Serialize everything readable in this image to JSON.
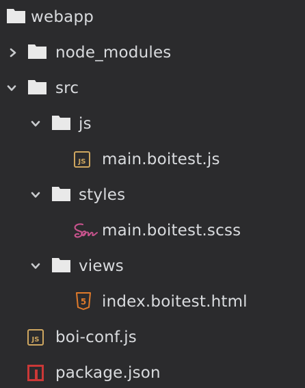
{
  "tree": {
    "root": {
      "label": "webapp",
      "icon": "folder-icon"
    },
    "items": [
      {
        "label": "node_modules",
        "icon": "folder-icon",
        "state": "collapsed"
      },
      {
        "label": "src",
        "icon": "folder-icon",
        "state": "expanded"
      },
      {
        "label": "js",
        "icon": "folder-icon",
        "state": "expanded"
      },
      {
        "label": "main.boitest.js",
        "icon": "javascript-file-icon",
        "badge": "JS"
      },
      {
        "label": "styles",
        "icon": "folder-icon",
        "state": "expanded"
      },
      {
        "label": "main.boitest.scss",
        "icon": "sass-file-icon"
      },
      {
        "label": "views",
        "icon": "folder-icon",
        "state": "expanded"
      },
      {
        "label": "index.boitest.html",
        "icon": "html5-file-icon",
        "badge": "5"
      },
      {
        "label": "boi-conf.js",
        "icon": "javascript-file-icon",
        "badge": "JS"
      },
      {
        "label": "package.json",
        "icon": "npm-file-icon"
      }
    ]
  },
  "colors": {
    "background": "#2b2b2d",
    "text": "#d9dbde",
    "folder": "#e9e9e9",
    "javascript": "#cfa760",
    "sass": "#c6538c",
    "html5": "#e17b2b",
    "npm": "#cb3837"
  }
}
